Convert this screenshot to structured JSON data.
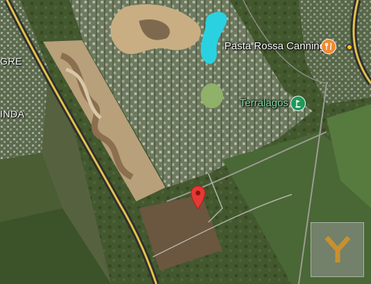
{
  "map": {
    "type": "satellite",
    "area_labels": [
      {
        "text": "GRE"
      },
      {
        "text": "INDA"
      }
    ],
    "pois": [
      {
        "name": "Pasta Rossa Canning",
        "icon": "restaurant-icon",
        "color": "#f08a34"
      },
      {
        "name": "Terralagos",
        "icon": "golf-icon",
        "color": "#1f9a5a"
      }
    ],
    "marker": {
      "icon": "location-pin-icon",
      "color": "#e53935"
    },
    "transit_marker": {
      "icon": "transit-dot-icon",
      "color": "#f7c71c"
    },
    "watermark": {
      "letter": "Y",
      "color": "#c8902e"
    }
  }
}
